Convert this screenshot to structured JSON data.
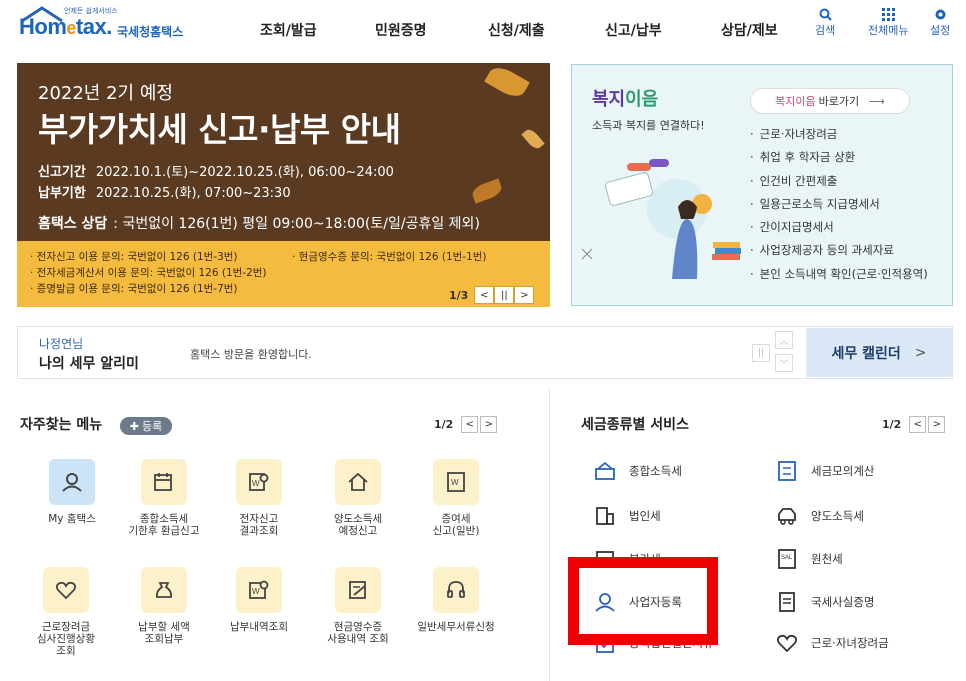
{
  "header": {
    "logo_small": "언제든 쉽게서비스",
    "logo_main_prefix": "Hom",
    "logo_main_e": "e",
    "logo_main_suffix": "tax.",
    "logo_sub": "국세청홈택스",
    "nav": [
      "조회/발급",
      "민원증명",
      "신청/제출",
      "신고/납부",
      "상담/제보"
    ],
    "search_label": "검색",
    "allmenu_label": "전체메뉴",
    "settings_label": "설정"
  },
  "banner": {
    "subtitle": "2022년 2기 예정",
    "title": "부가가치세 신고·납부 안내",
    "period1_label": "신고기간",
    "period1_value": "2022.10.1.(토)~2022.10.25.(화), 06:00~24:00",
    "period2_label": "납부기한",
    "period2_value": "2022.10.25.(화), 07:00~23:30",
    "contact_label": "홈택스 상담",
    "contact_value": ": 국번없이 126(1번) 평일 09:00~18:00(토/일/공휴일 제외)",
    "lines": [
      "· 전자신고 이용 문의: 국번없이 126 (1번-3번)",
      "· 현금영수증 문의: 국번없이 126 (1번-1번)",
      "· 전자세금계산서 이용 문의: 국번없이 126 (1번-2번)",
      "· 증명발급 이용 문의: 국번없이 126 (1번-7번)"
    ],
    "page": "1/3"
  },
  "welfare": {
    "title_a": "복지",
    "title_b": "이음",
    "desc": "소득과 복지를 연결하다!",
    "btn_highlight": "복지이음",
    "btn_text": "바로가기",
    "items": [
      "근로·자녀장려금",
      "취업 후 학자금 상환",
      "인건비 간편제출",
      "일용근로소득 지급명세서",
      "간이지급명세서",
      "사업장제공자 등의 과세자료",
      "본인 소득내역 확인(근로·인적용역)"
    ]
  },
  "alarm": {
    "name": "나정연님",
    "title": "나의 세무 알리미",
    "message": "홈택스 방문을 환영합니다.",
    "calendar": "세무 캘린더"
  },
  "favorites": {
    "title": "자주찾는 메뉴",
    "register": "등록",
    "page": "1/2",
    "items": [
      {
        "label": "My 홈택스",
        "icon": "user-icon"
      },
      {
        "label": "종합소득세\n기한후 환급신고",
        "icon": "calendar-icon"
      },
      {
        "label": "전자신고\n결과조회",
        "icon": "document-search-icon"
      },
      {
        "label": "양도소득세\n예정신고",
        "icon": "house-icon"
      },
      {
        "label": "증여세\n신고(일반)",
        "icon": "document-w-icon"
      },
      {
        "label": "근로장려금\n심사진행상황\n조회",
        "icon": "heart-check-icon"
      },
      {
        "label": "납부할 세액\n조회납부",
        "icon": "money-bag-icon"
      },
      {
        "label": "납부내역조회",
        "icon": "receipt-search-icon"
      },
      {
        "label": "현금영수증\n사용내역 조회",
        "icon": "receipt-edit-icon"
      },
      {
        "label": "일반세무서류신청",
        "icon": "headset-icon"
      }
    ]
  },
  "services": {
    "title": "세금종류별 서비스",
    "page": "1/2",
    "left": [
      "종합소득세",
      "법인세",
      "부가세",
      "사업자등록",
      "공익법인결산서류"
    ],
    "right": [
      "세금모의계산",
      "양도소득세",
      "원천세",
      "국세사실증명",
      "근로·자녀장려금"
    ]
  },
  "colors": {
    "banner_bg": "#5a3b22",
    "banner_bottom": "#f5bb3e",
    "brand_blue": "#1b65c2",
    "highlight_red": "#ef0000"
  }
}
